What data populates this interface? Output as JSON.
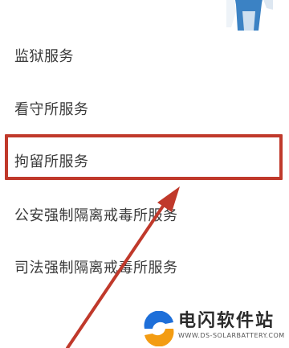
{
  "menu": {
    "items": [
      {
        "label": "监狱服务"
      },
      {
        "label": "看守所服务"
      },
      {
        "label": "拘留所服务"
      },
      {
        "label": "公安强制隔离戒毒所服务"
      },
      {
        "label": "司法强制隔离戒毒所服务"
      }
    ],
    "highlighted_index": 2
  },
  "watermark": {
    "title": "电闪软件站",
    "subtitle": "WWW.DS-SOLARBATTERY.COM"
  },
  "colors": {
    "highlight": "#c0392b",
    "arrow": "#c0392b",
    "text": "#3a3a3a",
    "illustration": "#3b82c4",
    "logo_blue": "#1e6fd9",
    "logo_orange": "#f39c12"
  },
  "icons": {
    "top": "person-illustration-icon",
    "watermark": "ds-logo-icon"
  }
}
